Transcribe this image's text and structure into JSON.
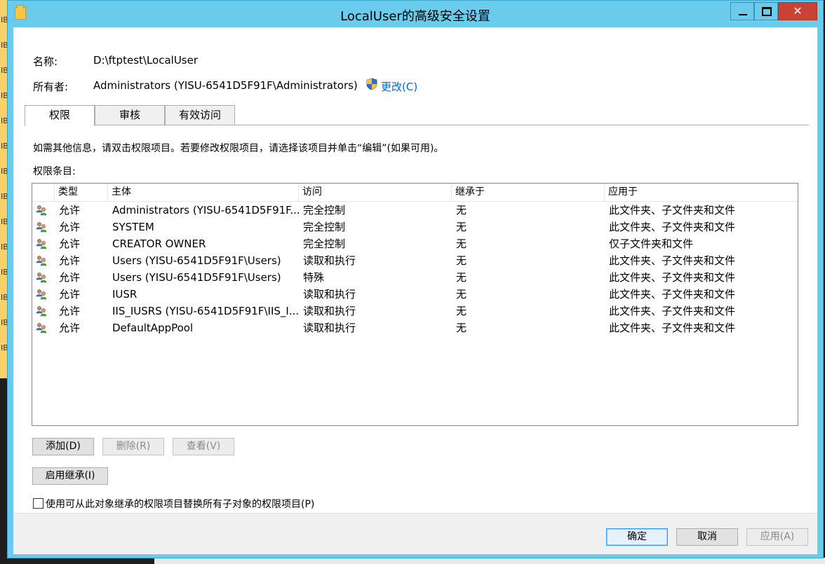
{
  "window": {
    "title": "LocalUser的高级安全设置"
  },
  "background": {
    "strip_labels": [
      "IB",
      "IB",
      "IB",
      "IB",
      "IB",
      "IB",
      "IB",
      "IB",
      "IB",
      "IB",
      "IB",
      "IB",
      "IB",
      "IB"
    ]
  },
  "header": {
    "name_label": "名称:",
    "name_value": "D:\\ftptest\\LocalUser",
    "owner_label": "所有者:",
    "owner_value": "Administrators (YISU-6541D5F91F\\Administrators)",
    "change_link": "更改(C)"
  },
  "tabs": [
    {
      "label": "权限",
      "active": true
    },
    {
      "label": "审核",
      "active": false
    },
    {
      "label": "有效访问",
      "active": false
    }
  ],
  "permissions": {
    "info_text": "如需其他信息，请双击权限项目。若要修改权限项目，请选择该项目并单击“编辑”(如果可用)。",
    "entries_label": "权限条目:",
    "columns": [
      "类型",
      "主体",
      "访问",
      "继承于",
      "应用于"
    ],
    "rows": [
      {
        "type": "允许",
        "principal": "Administrators (YISU-6541D5F91F...",
        "access": "完全控制",
        "inherited": "无",
        "applies": "此文件夹、子文件夹和文件"
      },
      {
        "type": "允许",
        "principal": "SYSTEM",
        "access": "完全控制",
        "inherited": "无",
        "applies": "此文件夹、子文件夹和文件"
      },
      {
        "type": "允许",
        "principal": "CREATOR OWNER",
        "access": "完全控制",
        "inherited": "无",
        "applies": "仅子文件夹和文件"
      },
      {
        "type": "允许",
        "principal": "Users (YISU-6541D5F91F\\Users)",
        "access": "读取和执行",
        "inherited": "无",
        "applies": "此文件夹、子文件夹和文件"
      },
      {
        "type": "允许",
        "principal": "Users (YISU-6541D5F91F\\Users)",
        "access": "特殊",
        "inherited": "无",
        "applies": "此文件夹、子文件夹和文件"
      },
      {
        "type": "允许",
        "principal": "IUSR",
        "access": "读取和执行",
        "inherited": "无",
        "applies": "此文件夹、子文件夹和文件"
      },
      {
        "type": "允许",
        "principal": "IIS_IUSRS (YISU-6541D5F91F\\IIS_I...",
        "access": "读取和执行",
        "inherited": "无",
        "applies": "此文件夹、子文件夹和文件"
      },
      {
        "type": "允许",
        "principal": "DefaultAppPool",
        "access": "读取和执行",
        "inherited": "无",
        "applies": "此文件夹、子文件夹和文件"
      }
    ],
    "add_button": "添加(D)",
    "remove_button": "删除(R)",
    "view_button": "查看(V)",
    "enable_inheritance_button": "启用继承(I)",
    "replace_checkbox_label": "使用可从此对象继承的权限项目替换所有子对象的权限项目(P)"
  },
  "footer": {
    "ok_button": "确定",
    "cancel_button": "取消",
    "apply_button": "应用(A)"
  }
}
